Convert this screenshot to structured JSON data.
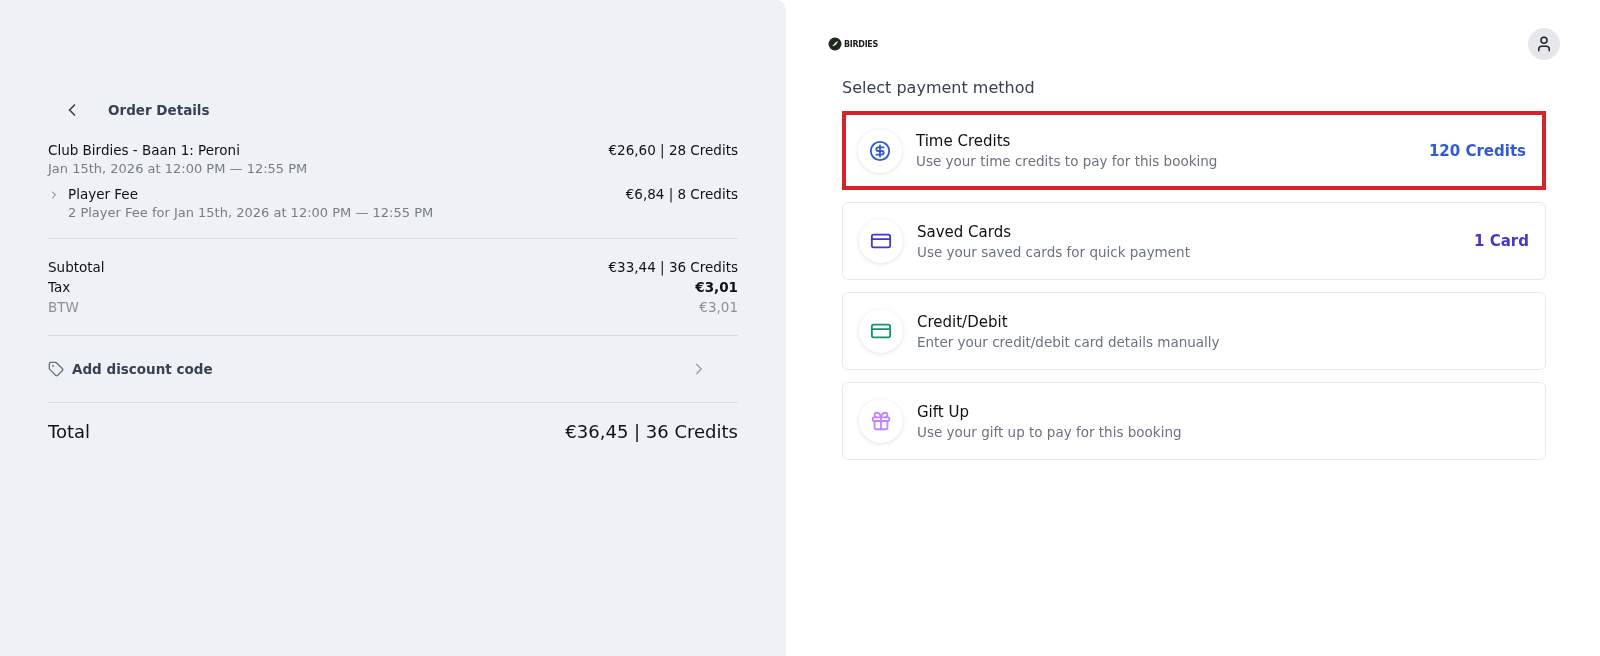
{
  "order": {
    "title": "Order Details",
    "items": [
      {
        "name": "Club Birdies - Baan 1: Peroni",
        "detail": "Jan 15th, 2026 at 12:00 PM — 12:55 PM",
        "price": "€26,60 | 28 Credits",
        "children": [
          {
            "name": "Player Fee",
            "detail": "2 Player Fee for Jan 15th, 2026 at 12:00 PM — 12:55 PM",
            "price": "€6,84 | 8 Credits",
            "expanded": false
          }
        ]
      }
    ],
    "summary": [
      {
        "label": "Subtotal",
        "value": "€33,44 | 36 Credits",
        "kind": "main"
      },
      {
        "label": "Tax",
        "value": "€3,01",
        "kind": "strong"
      },
      {
        "label": "BTW",
        "value": "€3,01",
        "kind": "muted"
      }
    ],
    "discount": "Add discount code",
    "total": {
      "label": "Total",
      "value": "€36,45 | 36 Credits"
    }
  },
  "header": {
    "logo": "BIRDIES"
  },
  "payment": {
    "title": "Select payment method",
    "methods": [
      {
        "kind": "credits",
        "name": "Time Credits",
        "description": "Use your time credits to pay for this booking",
        "value": "120 Credits",
        "color": "#2f5bd0",
        "selected": true
      },
      {
        "kind": "saved",
        "name": "Saved Cards",
        "description": "Use your saved cards for quick payment",
        "value": "1 Card",
        "color": "#4338ca",
        "selected": false
      },
      {
        "kind": "card",
        "name": "Credit/Debit",
        "description": "Enter your credit/debit card details manually",
        "color": "#15946e",
        "selected": false
      },
      {
        "kind": "gift",
        "name": "Gift Up",
        "description": "Use your gift up to pay for this booking",
        "color": "#c084fc",
        "selected": false
      }
    ]
  }
}
